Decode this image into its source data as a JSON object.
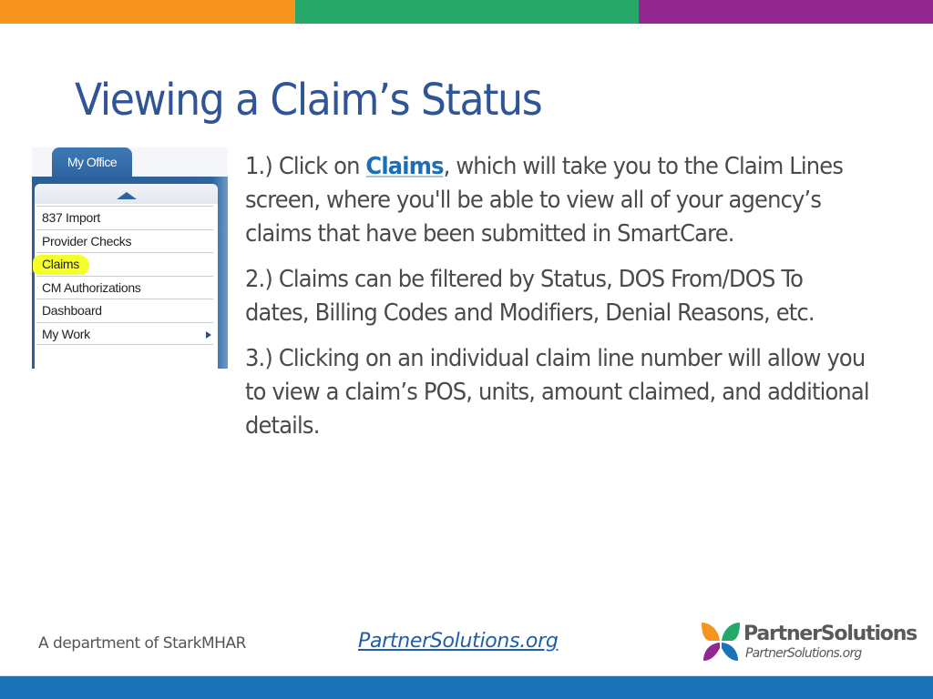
{
  "colors": {
    "top_bar": [
      "#f7941e",
      "#27a86b",
      "#92278f"
    ],
    "title": "#2f5597",
    "body_text": "#4a4a4a",
    "link": "#1a6fb8",
    "bottom_bar": "#1a72b8",
    "highlight": "#f5ff2a"
  },
  "slide": {
    "title": "Viewing a Claim’s Status"
  },
  "menu_screenshot": {
    "tab_label": "My Office",
    "items": [
      {
        "label": "837 Import",
        "highlighted": false,
        "has_submenu": false
      },
      {
        "label": "Provider Checks",
        "highlighted": false,
        "has_submenu": false
      },
      {
        "label": "Claims",
        "highlighted": true,
        "has_submenu": false
      },
      {
        "label": "CM Authorizations",
        "highlighted": false,
        "has_submenu": false
      },
      {
        "label": "Dashboard",
        "highlighted": false,
        "has_submenu": false
      },
      {
        "label": "My Work",
        "highlighted": false,
        "has_submenu": true
      }
    ]
  },
  "steps": [
    {
      "prefix": "1.) Click on ",
      "link": "Claims",
      "suffix": ", which will take you to the Claim Lines screen, where you'll be able to view all of your agency’s claims that have been submitted in SmartCare."
    },
    {
      "text": "2.) Claims can be filtered by Status, DOS From/DOS To dates, Billing Codes and Modifiers, Denial Reasons, etc."
    },
    {
      "text": "3.) Clicking on an individual claim line number will allow you to view a claim’s POS, units, amount claimed, and additional details."
    }
  ],
  "footer": {
    "department": "A department of StarkMHAR",
    "url": "PartnerSolutions.org",
    "logo_name": "PartnerSolutions",
    "logo_url": "PartnerSolutions.org",
    "logo_icon": "butterfly-icon"
  }
}
